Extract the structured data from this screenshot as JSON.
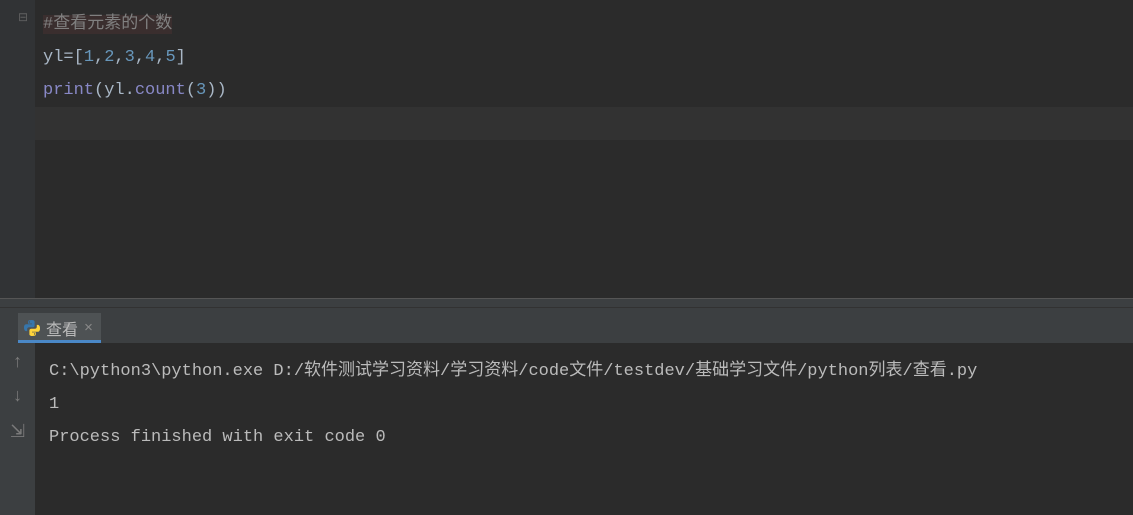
{
  "editor": {
    "comment": "#查看元素的个数",
    "line2": {
      "var": "yl",
      "eq": "=",
      "lb": "[",
      "n1": "1",
      "c1": ",",
      "n2": "2",
      "c2": ",",
      "n3": "3",
      "c3": ",",
      "n4": "4",
      "c4": ",",
      "n5": "5",
      "rb": "]"
    },
    "line3": {
      "print": "print",
      "lp": "(",
      "obj": "yl",
      "dot": ".",
      "method": "count",
      "lp2": "(",
      "arg": "3",
      "rp2": ")",
      "rp": ")"
    }
  },
  "tab": {
    "label": "查看",
    "close": "×"
  },
  "console": {
    "line1_pre": "C:\\python3\\python.exe D:",
    "line1_s1": "/",
    "line1_p1": "软件测试学习资料",
    "line1_s2": "/",
    "line1_p2": "学习资料",
    "line1_s3": "/",
    "line1_p3": "code文件",
    "line1_s4": "/",
    "line1_p4": "testdev",
    "line1_s5": "/",
    "line1_p5": "基础学习文件",
    "line1_s6": "/",
    "line1_p6": "python列表",
    "line1_s7": "/",
    "line1_p7": "查看",
    "line1_ext": ".py",
    "line2": "1",
    "line3": "",
    "line4": "Process finished with exit code 0"
  },
  "icons": {
    "up": "↑",
    "down": "↓",
    "wrap": "⇲"
  }
}
